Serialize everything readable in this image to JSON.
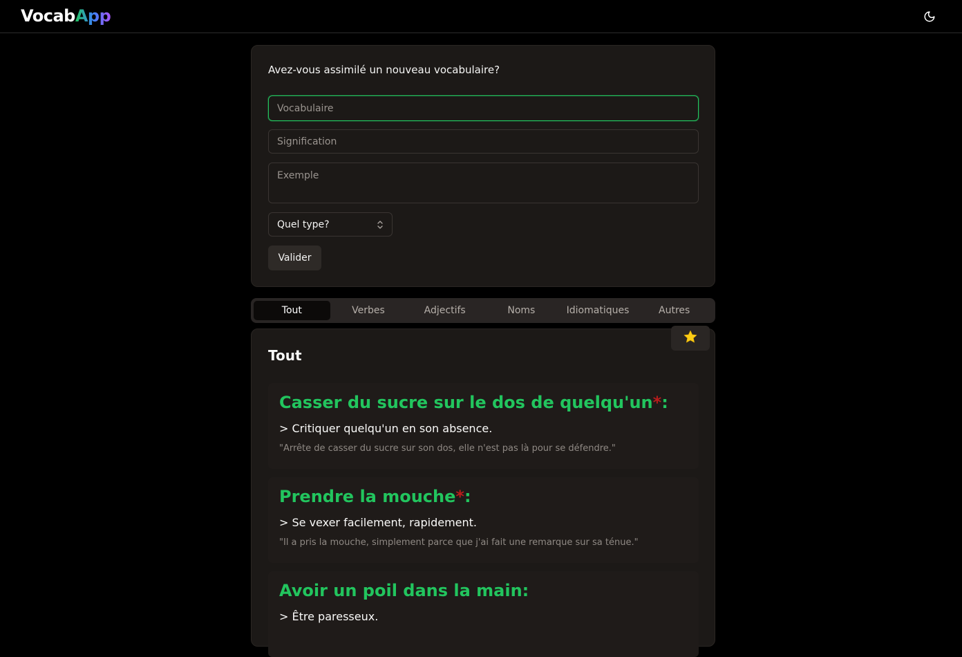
{
  "app": {
    "logo_part1": "Vocab",
    "logo_part2": "App",
    "theme_icon": "moon-icon"
  },
  "form": {
    "title": "Avez-vous assimilé un nouveau vocabulaire?",
    "vocab_placeholder": "Vocabulaire",
    "meaning_placeholder": "Signification",
    "example_placeholder": "Exemple",
    "type_select": "Quel type?",
    "submit_label": "Valider"
  },
  "tabs": [
    {
      "label": "Tout",
      "active": true
    },
    {
      "label": "Verbes",
      "active": false
    },
    {
      "label": "Adjectifs",
      "active": false
    },
    {
      "label": "Noms",
      "active": false
    },
    {
      "label": "Idiomatiques",
      "active": false
    },
    {
      "label": "Autres",
      "active": false
    }
  ],
  "list": {
    "title": "Tout",
    "favorite_icon": "star-icon",
    "entries": [
      {
        "word": "Casser du sucre sur le dos de quelqu'un",
        "marker": "*",
        "colon": ":",
        "meaning": "> Critiquer quelqu'un en son absence.",
        "example": "\"Arrête de casser du sucre sur son dos, elle n'est pas là pour se défendre.\""
      },
      {
        "word": "Prendre la mouche",
        "marker": "*",
        "colon": ":",
        "meaning": "> Se vexer facilement, rapidement.",
        "example": "\"Il a pris la mouche, simplement parce que j'ai fait une remarque sur sa ténue.\""
      },
      {
        "word": "Avoir un poil dans la main",
        "marker": "",
        "colon": ":",
        "meaning": "> Être paresseux.",
        "example": ""
      }
    ]
  },
  "colors": {
    "accent_green": "#22c55e",
    "marker_red": "#b91c1c",
    "star_yellow": "#facc15"
  }
}
